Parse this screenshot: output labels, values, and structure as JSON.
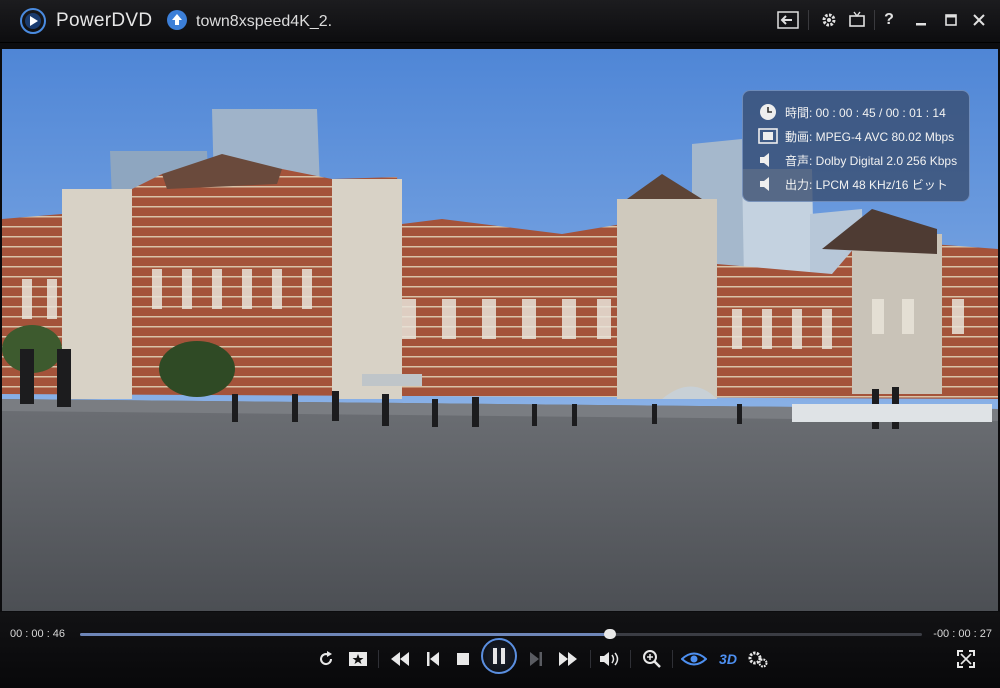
{
  "app": {
    "name": "PowerDVD",
    "file_name": "town8xspeed4K_2."
  },
  "titlebar": {
    "icons": [
      "back-arrow-icon",
      "gear-icon",
      "tv-icon",
      "help-icon",
      "minimize-icon",
      "maximize-icon",
      "close-icon"
    ],
    "help_label": "?"
  },
  "info_panel": {
    "time": "時間: 00 : 00 : 45 / 00 : 01 : 14",
    "video": "動画: MPEG-4 AVC  80.02 Mbps",
    "audio": "音声: Dolby Digital 2.0  256 Kbps",
    "output": "出力: LPCM 48 KHz/16 ビット"
  },
  "playback": {
    "elapsed": "00 : 00 : 46",
    "remaining": "-00 : 00 : 27",
    "progress_fraction": 0.63
  },
  "controls": {
    "buttons": [
      "repeat-icon",
      "bookmark-icon",
      "rewind-icon",
      "previous-icon",
      "stop-icon",
      "pause-icon",
      "next-icon",
      "fast-forward-icon",
      "volume-icon",
      "zoom-icon",
      "eye-icon",
      "3d-icon",
      "settings-icon",
      "fullscreen-icon"
    ],
    "three_d_label": "3D"
  },
  "colors": {
    "accent": "#5b8fe0",
    "sky": "#6f9ee0",
    "brick": "#a4533a"
  }
}
